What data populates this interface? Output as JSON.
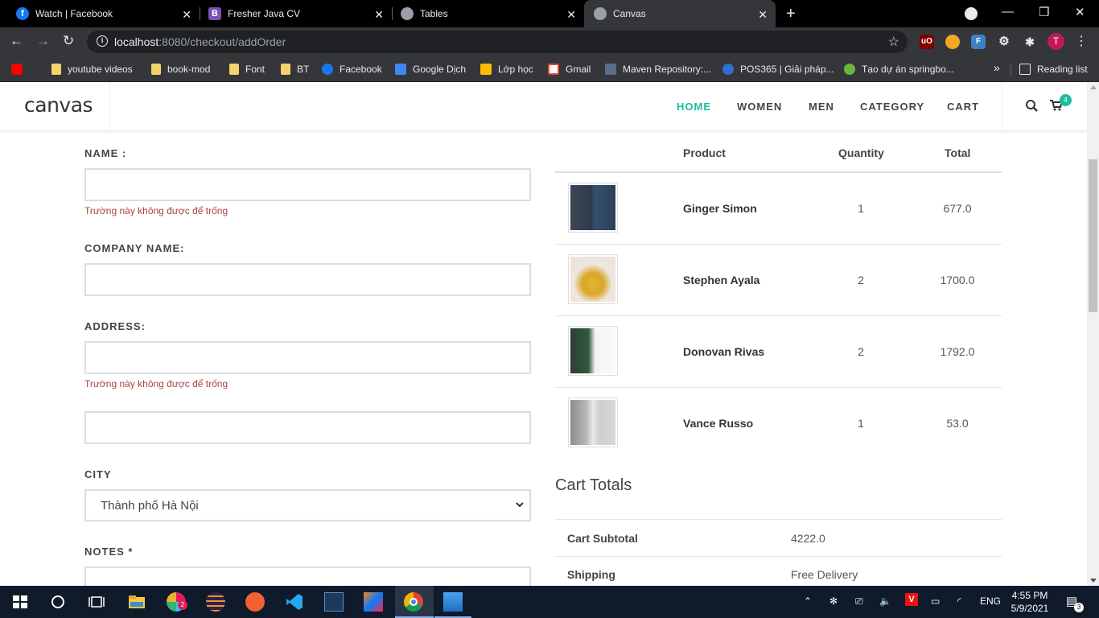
{
  "browser": {
    "tabs": [
      {
        "title": "Watch | Facebook",
        "favicon": "facebook-icon",
        "active": false
      },
      {
        "title": "Fresher Java CV",
        "favicon": "bootstrap-icon",
        "active": false
      },
      {
        "title": "Tables",
        "favicon": "globe-icon",
        "active": false
      },
      {
        "title": "Canvas",
        "favicon": "globe-icon",
        "active": true
      }
    ],
    "url_host": "localhost",
    "url_rest": ":8080/checkout/addOrder",
    "profile_initial": "T",
    "bookmarks": [
      "youtube videos",
      "book-mod",
      "Font",
      "BT",
      "Facebook",
      "Google Dịch",
      "Lớp học",
      "Gmail",
      "Maven Repository:...",
      "POS365 | Giải pháp...",
      "Tạo dự án springbo..."
    ],
    "reading_list": "Reading list"
  },
  "site": {
    "logo": "canvas",
    "nav": [
      "HOME",
      "WOMEN",
      "MEN",
      "CATEGORY",
      "CART"
    ],
    "cart_count": "4",
    "accent_color": "#1abc9c"
  },
  "form": {
    "name_label": "NAME :",
    "name_error": "Trường này không được để trống",
    "company_label": "COMPANY NAME:",
    "address_label": "ADDRESS:",
    "address_error": "Trường này không được để trống",
    "city_label": "CITY",
    "city_value": "Thành phố Hà Nội",
    "notes_label": "NOTES *"
  },
  "order": {
    "headers": {
      "product": "Product",
      "quantity": "Quantity",
      "total": "Total"
    },
    "items": [
      {
        "name": "Ginger Simon",
        "quantity": "1",
        "total": "677.0"
      },
      {
        "name": "Stephen Ayala",
        "quantity": "2",
        "total": "1700.0"
      },
      {
        "name": "Donovan Rivas",
        "quantity": "2",
        "total": "1792.0"
      },
      {
        "name": "Vance Russo",
        "quantity": "1",
        "total": "53.0"
      }
    ]
  },
  "totals": {
    "title": "Cart Totals",
    "subtotal_label": "Cart Subtotal",
    "subtotal_value": "4222.0",
    "shipping_label": "Shipping",
    "shipping_value": "Free Delivery"
  },
  "taskbar": {
    "language": "ENG",
    "time": "4:55 PM",
    "date": "5/9/2021",
    "notification_count": "3",
    "slack_badge": "2"
  }
}
